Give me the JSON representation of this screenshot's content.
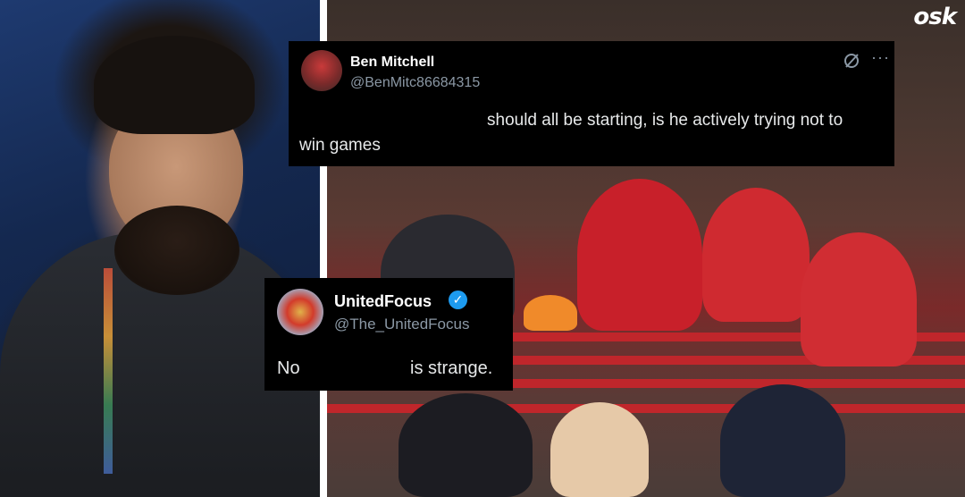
{
  "site_logo": "osk",
  "tweets": [
    {
      "display_name": "Ben Mitchell",
      "handle": "@BenMitc86684315",
      "text_line_1": "should all be starting, is he actively trying not to",
      "text_line_2": "win games",
      "icons": [
        "grok-icon",
        "more-icon"
      ]
    },
    {
      "display_name": "UnitedFocus",
      "handle": "@The_UnitedFocus",
      "verified": true,
      "text_left": "No",
      "text_right": "is strange."
    }
  ],
  "colors": {
    "tweet_background": "#000000",
    "text_primary": "#e7e9ea",
    "text_secondary": "#8b98a5",
    "verified_blue": "#1d9bf0"
  }
}
